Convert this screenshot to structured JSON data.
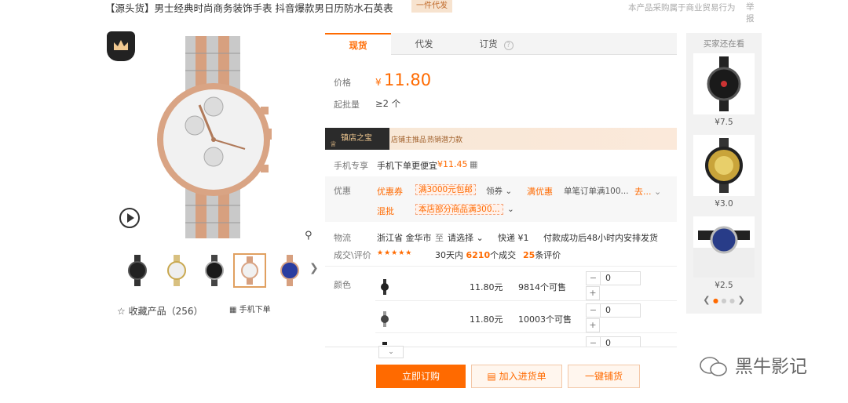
{
  "header": {
    "title": "【源头货】男士经典时尚商务装饰手表 抖音爆款男日历防水石英表",
    "dropship_badge": "一件代发",
    "notice": "本产品采购属于商业贸易行为",
    "report": "举报"
  },
  "gallery": {
    "thumbnails": [
      "black",
      "gold",
      "black-silver",
      "rose-gold",
      "blue"
    ],
    "selected_thumbnail": 3,
    "favorite_label": "收藏产品（256）",
    "mobile_order_label": "手机下单"
  },
  "tabs": [
    {
      "label": "现货",
      "active": true
    },
    {
      "label": "代发",
      "active": false
    },
    {
      "label": "订货",
      "active": false
    }
  ],
  "pricing": {
    "price_label": "价格",
    "currency": "¥",
    "price": "11.80",
    "min_qty_label": "起批量",
    "min_qty": "≥2 个"
  },
  "shop_banner": {
    "badge": "镇店之宝",
    "tag1": "店铺主推品",
    "tag2": "热销潜力款"
  },
  "mobile_exclusive": {
    "label": "手机专享",
    "text": "手机下单更便宜",
    "price": "¥11.45"
  },
  "promotions": {
    "label": "优惠",
    "coupon_label": "优惠券",
    "coupon_value": "满3000元包邮",
    "claim_label": "领券",
    "full_discount_label": "满优惠",
    "full_discount_value": "单笔订单满100...",
    "full_discount_action": "去...",
    "mixed_label": "混批",
    "mixed_value": "本店部分商品满300..."
  },
  "logistics": {
    "label": "物流",
    "origin": "浙江省 金华市",
    "to": "至",
    "select": "请选择",
    "express": "快递 ¥1",
    "promise": "付款成功后48小时内安排发货"
  },
  "reviews": {
    "label": "成交\\评价",
    "stars": "★★★★★",
    "deals_prefix": "30天内",
    "deals_count": "6210",
    "deals_suffix": "个成交",
    "review_count": "25",
    "review_suffix": "条评价"
  },
  "sku": {
    "label": "颜色",
    "rows": [
      {
        "price": "11.80元",
        "stock": "9814个可售",
        "qty": "0"
      },
      {
        "price": "11.80元",
        "stock": "10003个可售",
        "qty": "0"
      },
      {
        "price": "",
        "stock": "",
        "qty": "0"
      }
    ]
  },
  "actions": {
    "buy": "立即订购",
    "cart": "加入进货单",
    "distribute": "一键铺货"
  },
  "sidebar": {
    "title": "买家还在看",
    "items": [
      {
        "price": "¥7.5"
      },
      {
        "price": "¥3.0"
      },
      {
        "price": "¥2.5"
      }
    ]
  },
  "watermark": "黑牛影记",
  "colors": {
    "accent": "#ff6a00",
    "rose_gold": "#d9a484",
    "dark_badge": "#2b2b2b"
  }
}
